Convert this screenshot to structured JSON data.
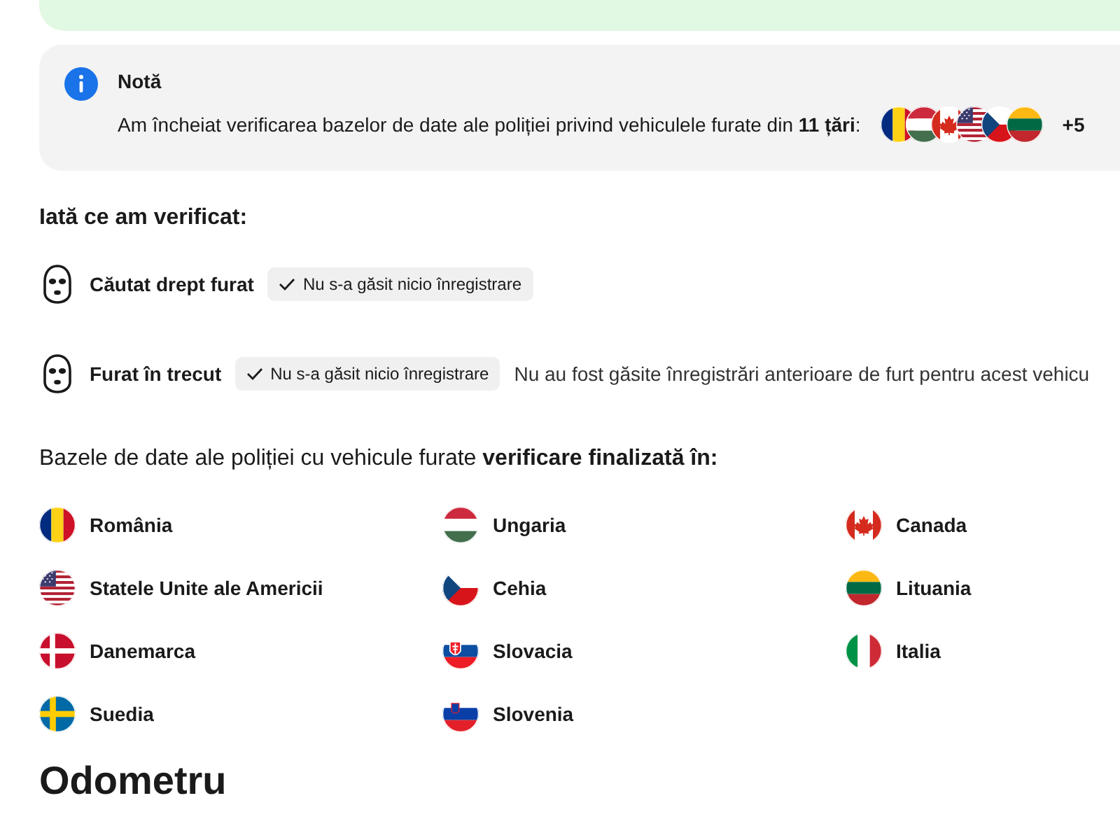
{
  "note": {
    "title": "Notă",
    "text": "Am încheiat verificarea bazelor de date ale poliției privind vehiculele furate din **11 țări**:",
    "flags": [
      {
        "kind": "ro"
      },
      {
        "kind": "hu"
      },
      {
        "kind": "ca"
      },
      {
        "kind": "us"
      },
      {
        "kind": "cz"
      },
      {
        "kind": "lt"
      }
    ],
    "more": "+5"
  },
  "checks_heading": "Iată ce am verificat:",
  "checks": [
    {
      "label": "Căutat drept furat",
      "status": "Nu s-a găsit nicio înregistrare"
    },
    {
      "label": "Furat în trecut",
      "status": "Nu s-a găsit nicio înregistrare",
      "detail": "Nu au fost găsite înregistrări anterioare de furt pentru acest vehicu"
    }
  ],
  "countries_heading": "Bazele de date ale poliției cu vehicule furate **verificare finalizată în:**",
  "countries": [
    {
      "name": "România",
      "kind": "ro"
    },
    {
      "name": "Ungaria",
      "kind": "hu"
    },
    {
      "name": "Canada",
      "kind": "ca"
    },
    {
      "name": "Statele Unite ale Americii",
      "kind": "us"
    },
    {
      "name": "Cehia",
      "kind": "cz"
    },
    {
      "name": "Lituania",
      "kind": "lt"
    },
    {
      "name": "Danemarca",
      "kind": "dk"
    },
    {
      "name": "Slovacia",
      "kind": "sk"
    },
    {
      "name": "Italia",
      "kind": "it"
    },
    {
      "name": "Suedia",
      "kind": "se"
    },
    {
      "name": "Slovenia",
      "kind": "si"
    }
  ],
  "section_title": "Odometru"
}
